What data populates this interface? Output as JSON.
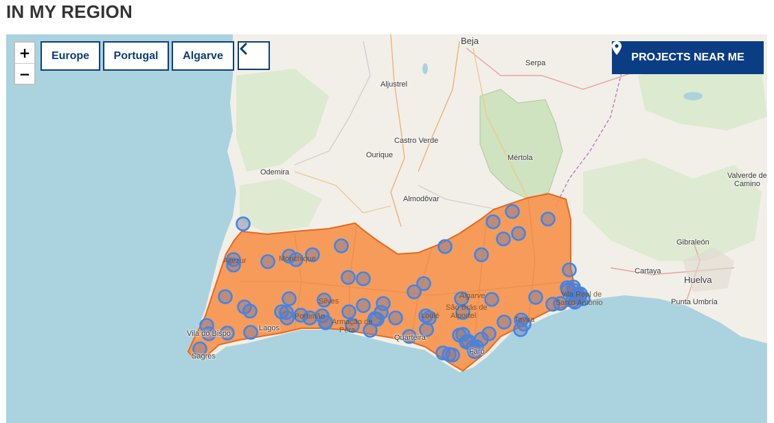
{
  "page": {
    "heading": "IN MY REGION"
  },
  "controls": {
    "zoom_in": "+",
    "zoom_out": "−",
    "breadcrumbs": [
      "Europe",
      "Portugal",
      "Algarve"
    ],
    "back_icon": "chevron-left-icon",
    "near_me": "PROJECTS NEAR ME",
    "near_me_icon": "map-pin-icon"
  },
  "colors": {
    "sea": "#aad3df",
    "land": "#f2efe9",
    "region_fill": "#f6914a",
    "region_stroke": "#e8671a",
    "marker_stroke": "#3a86f0",
    "button_blue": "#0b3d84"
  },
  "map": {
    "region_name": "Algarve",
    "places": {
      "beja": "Beja",
      "serpa": "Serpa",
      "aljustrel": "Aljustrel",
      "castro_verde": "Castro Verde",
      "ourique": "Ourique",
      "mertola": "Mértola",
      "odemira": "Odemira",
      "almodovar": "Almodôvar",
      "valverde": "Valverde del",
      "valverde2": "Camino",
      "gibraleon": "Gibraleón",
      "cartaya": "Cartaya",
      "huelva": "Huelva",
      "punta_umbria": "Punta Umbría",
      "aljezur": "Aljezur",
      "monchique": "Monchique",
      "silves": "Silves",
      "portimao": "Portimão",
      "lagos": "Lagos",
      "vila_do_bispo": "Vila do Bispo",
      "sagres": "Sagres",
      "loule": "Loulé",
      "sao_bras": "São Brás de",
      "sao_bras2": "Alportel",
      "quarteira": "Quarteira",
      "faro": "Faro",
      "tavira": "Tavira",
      "armacao": "Armação de",
      "armacao2": "Pêra",
      "algarve_label": "Algarve",
      "vrsa": "Vila Real de",
      "vrsa2": "Santo António"
    },
    "project_marker_count": 84
  }
}
